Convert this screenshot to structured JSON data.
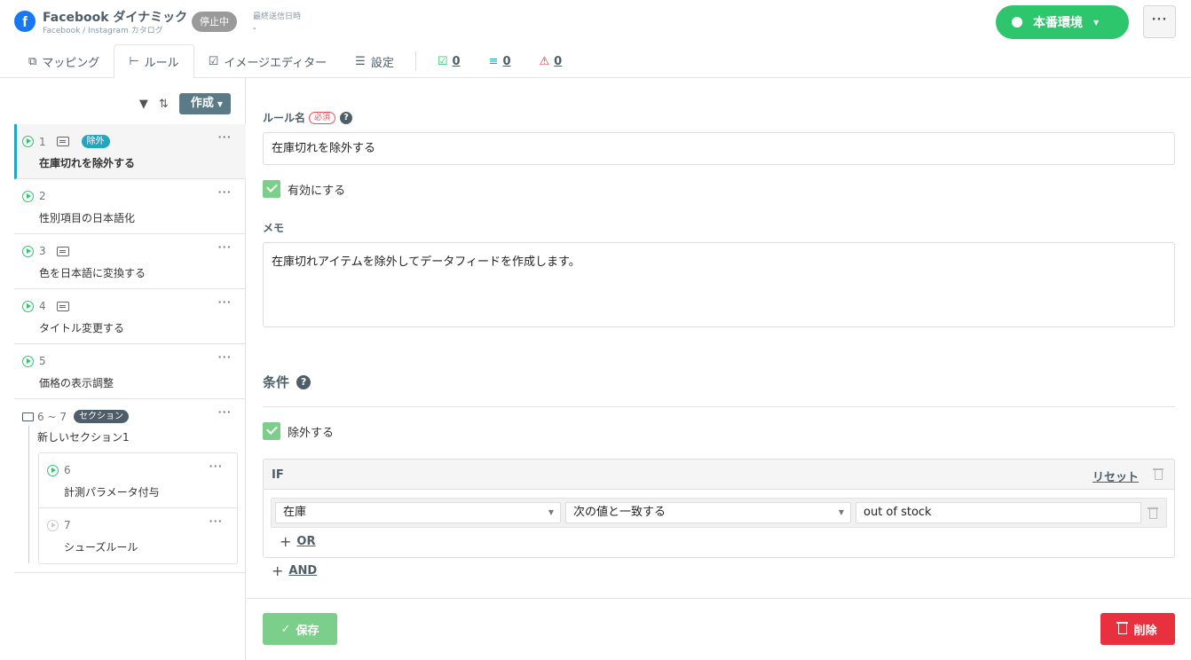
{
  "header": {
    "title": "Facebook ダイナミック",
    "subtitle": "Facebook / Instagram カタログ",
    "status": "停止中",
    "last_sent_label": "最終送信日時",
    "last_sent_value": "-",
    "env_label": "本番環境",
    "more_label": "···"
  },
  "tabs": [
    {
      "label": "マッピング",
      "icon": "mapping-icon"
    },
    {
      "label": "ルール",
      "icon": "rules-icon",
      "active": true
    },
    {
      "label": "イメージエディター",
      "icon": "image-editor-icon"
    },
    {
      "label": "設定",
      "icon": "settings-icon"
    }
  ],
  "counts": {
    "success": "0",
    "excluded": "0",
    "warnings": "0"
  },
  "sidebar": {
    "create_label": "作成",
    "rules": [
      {
        "num": "1",
        "title": "在庫切れを除外する",
        "badge": "除外",
        "memo": true,
        "active": true,
        "selected": true
      },
      {
        "num": "2",
        "title": "性別項目の日本語化",
        "memo": false,
        "active": true
      },
      {
        "num": "3",
        "title": "色を日本語に変換する",
        "memo": true,
        "active": true
      },
      {
        "num": "4",
        "title": "タイトル変更する",
        "memo": true,
        "active": true
      },
      {
        "num": "5",
        "title": "価格の表示調整",
        "memo": false,
        "active": true
      }
    ],
    "section": {
      "range": "6 ~ 7",
      "badge": "セクション",
      "title": "新しいセクション1",
      "rules": [
        {
          "num": "6",
          "title": "計測パラメータ付与",
          "active": true
        },
        {
          "num": "7",
          "title": "シューズルール",
          "active": false
        }
      ]
    },
    "menu_label": "···"
  },
  "form": {
    "rule_name_label": "ルール名",
    "required_label": "必須",
    "rule_name_value": "在庫切れを除外する",
    "enable_label": "有効にする",
    "memo_label": "メモ",
    "memo_value": "在庫切れアイテムを除外してデータフィードを作成します。",
    "conditions_label": "条件",
    "exclude_label": "除外する",
    "if_label": "IF",
    "reset_label": "リセット",
    "condition": {
      "field": "在庫",
      "operator": "次の値と一致する",
      "value": "out of stock"
    },
    "or_label": "OR",
    "and_label": "AND",
    "save_label": "保存",
    "delete_label": "削除"
  },
  "colors": {
    "accent": "#22a5c1",
    "env_green": "#2ec66d",
    "save_green": "#7ccf8a",
    "delete_red": "#e8303f",
    "heading": "#4d5e69"
  }
}
